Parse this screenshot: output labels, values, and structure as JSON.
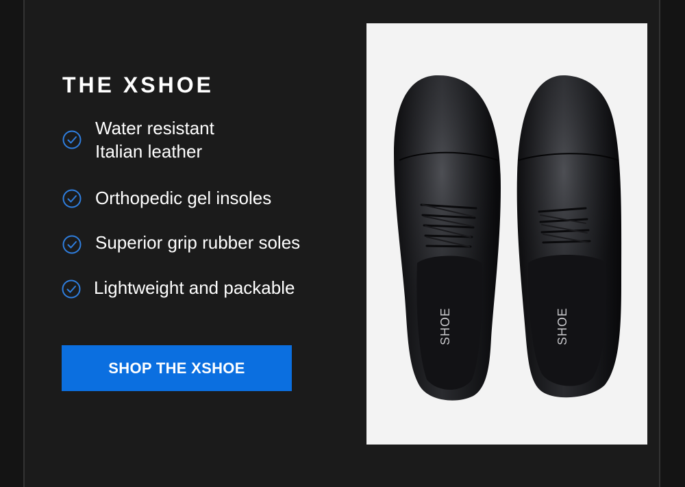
{
  "promo": {
    "title": "THE XSHOE",
    "features": [
      "Water resistant\nItalian leather",
      "Orthopedic gel insoles",
      "Superior grip rubber soles",
      "Lightweight and packable"
    ],
    "cta_label": "SHOP THE XSHOE"
  },
  "product_image": {
    "insole_brand_text": "SHOE"
  },
  "colors": {
    "background": "#141414",
    "panel": "#1b1b1b",
    "accent": "#0b6fe0",
    "check_icon": "#2f7fe0",
    "photo_background": "#f3f3f3"
  }
}
